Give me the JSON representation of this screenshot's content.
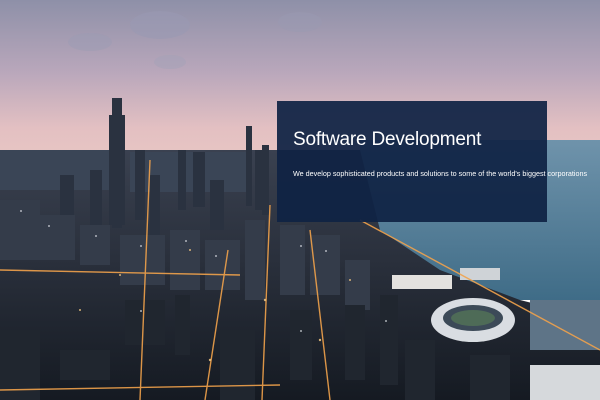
{
  "hero": {
    "image": "city-skyline-background",
    "title": "Software Development",
    "description": "We develop sophisticated products and solutions to some of the world's biggest corporations"
  },
  "colors": {
    "overlay": "#0f2244",
    "sky_top": "#8f8ea6",
    "sky_horizon": "#e7c3c3",
    "lake": "#4f7f99",
    "city_dark": "#1f2732",
    "city_light": "#f2a24a"
  }
}
